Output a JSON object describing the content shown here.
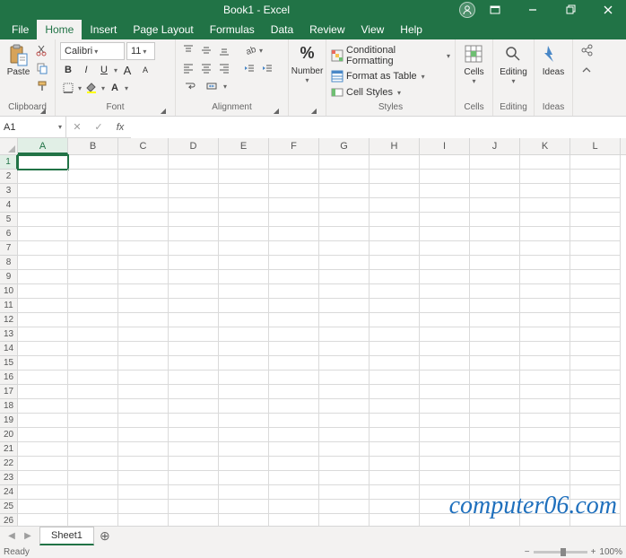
{
  "title": "Book1 - Excel",
  "window": {
    "minimize": "Minimize",
    "restore": "Restore",
    "close": "Close"
  },
  "account": {
    "label": "Account"
  },
  "ribbonDisplay": {
    "label": "Ribbon Display Options"
  },
  "tabs": [
    "File",
    "Home",
    "Insert",
    "Page Layout",
    "Formulas",
    "Data",
    "Review",
    "View",
    "Help"
  ],
  "activeTab": "Home",
  "share": {
    "label": "Share"
  },
  "collapse": {
    "label": "Collapse Ribbon"
  },
  "clipboard": {
    "label": "Clipboard",
    "paste": "Paste",
    "cut": "Cut",
    "copy": "Copy",
    "formatPainter": "Format Painter"
  },
  "font": {
    "label": "Font",
    "name": "Calibri",
    "size": "11",
    "bold": "B",
    "italic": "I",
    "underline": "U",
    "border": "Borders",
    "fill": "Fill Color",
    "color": "Font Color",
    "grow": "A",
    "shrink": "A"
  },
  "alignment": {
    "label": "Alignment",
    "top": "Top Align",
    "middle": "Middle Align",
    "bottom": "Bottom Align",
    "left": "Align Left",
    "center": "Center",
    "right": "Align Right",
    "decIndent": "Decrease Indent",
    "incIndent": "Increase Indent",
    "orient": "Orientation",
    "wrap": "Wrap Text",
    "merge": "Merge & Center"
  },
  "number": {
    "label": "Number",
    "percent": "%",
    "format": "Number Format"
  },
  "styles": {
    "label": "Styles",
    "cond": "Conditional Formatting",
    "table": "Format as Table",
    "cell": "Cell Styles"
  },
  "cells": {
    "label": "Cells",
    "btn": "Cells"
  },
  "editing": {
    "label": "Editing",
    "btn": "Editing"
  },
  "ideas": {
    "label": "Ideas",
    "btn": "Ideas"
  },
  "namebox": "A1",
  "formula": "",
  "fx": {
    "cancel": "Cancel",
    "enter": "Enter",
    "insert": "Insert Function"
  },
  "columns": [
    "A",
    "B",
    "C",
    "D",
    "E",
    "F",
    "G",
    "H",
    "I",
    "J",
    "K",
    "L"
  ],
  "rowCount": 26,
  "activeCell": {
    "col": 0,
    "row": 0
  },
  "sheet": {
    "nav": {
      "first": "First",
      "prev": "Previous",
      "next": "Next",
      "last": "Last"
    },
    "active": "Sheet1",
    "add": "New sheet"
  },
  "status": {
    "ready": "Ready",
    "zoom": "100%",
    "zoomOut": "−",
    "zoomIn": "+"
  },
  "watermark": "computer06.com"
}
